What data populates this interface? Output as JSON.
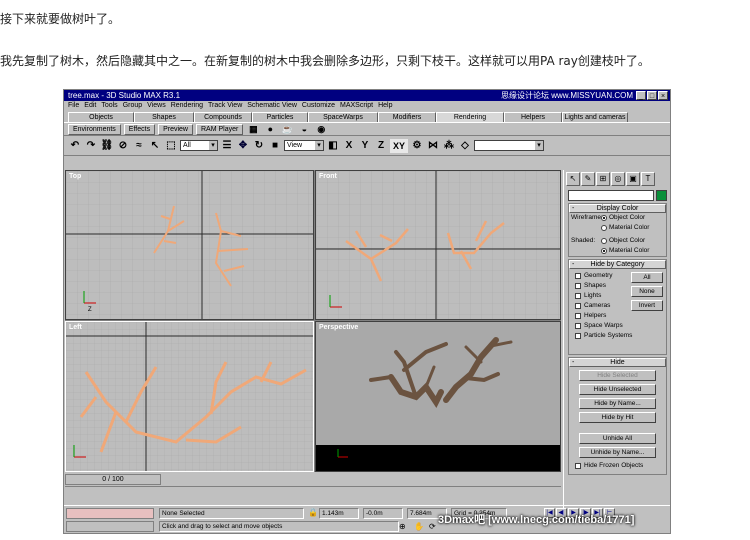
{
  "article": {
    "p1": "接下来就要做树叶了。",
    "p2": "我先复制了树木，然后隐藏其中之一。在新复制的树木中我会删除多边形，只剩下枝干。这样就可以用PA ray创建枝叶了。"
  },
  "window": {
    "title": "tree.max - 3D Studio MAX R3.1",
    "watermark": "思缘设计论坛 www.MISSYUAN.COM",
    "footer_watermark": "3Dmax吧 [www.lnecg.com/tieba/1771]"
  },
  "menu": [
    "File",
    "Edit",
    "Tools",
    "Group",
    "Views",
    "Rendering",
    "Track View",
    "Schematic View",
    "Customize",
    "MAXScript",
    "Help"
  ],
  "tabs": [
    {
      "label": "Objects"
    },
    {
      "label": "Shapes"
    },
    {
      "label": "Compounds"
    },
    {
      "label": "Particles"
    },
    {
      "label": "SpaceWarps"
    },
    {
      "label": "Modifiers"
    },
    {
      "label": "Rendering"
    },
    {
      "label": "Helpers"
    },
    {
      "label": "Lights and cameras"
    }
  ],
  "active_tab": "Rendering",
  "subtoolbar": [
    "Environments",
    "Effects",
    "Preview",
    "RAM Player"
  ],
  "toolbar": {
    "selection_filter": "All",
    "coord_system": "View",
    "axis_x": "X",
    "axis_y": "Y",
    "axis_z": "Z",
    "axis_xy": "XY"
  },
  "viewports": {
    "top": "Top",
    "front": "Front",
    "left": "Left",
    "perspective": "Perspective"
  },
  "command_panel": {
    "display_color": {
      "title": "Display Color",
      "wireframe_label": "Wireframe:",
      "shaded_label": "Shaded:",
      "object_color": "Object Color",
      "material_color": "Material Color"
    },
    "hide_by_category": {
      "title": "Hide by Category",
      "items": [
        "Geometry",
        "Shapes",
        "Lights",
        "Cameras",
        "Helpers",
        "Space Warps",
        "Particle Systems"
      ],
      "all": "All",
      "none": "None",
      "invert": "Invert"
    },
    "hide": {
      "title": "Hide",
      "hide_selected": "Hide Selected",
      "hide_unselected": "Hide Unselected",
      "hide_by_name": "Hide by Name...",
      "hide_by_hit": "Hide by Hit",
      "unhide_all": "Unhide All",
      "unhide_by_name": "Unhide by Name...",
      "hide_frozen": "Hide Frozen Objects"
    }
  },
  "timeline": {
    "frame": "0 / 100"
  },
  "status": {
    "selection": "None Selected",
    "prompt": "Click and drag to select and move objects",
    "x": "1.143m",
    "y": "-0.0m",
    "z": "7.684m",
    "grid": "Grid = 0.254m"
  },
  "colors": {
    "branch_wire": "#f0a878",
    "titlebar": "#000080",
    "ui_gray": "#c0c0c0"
  }
}
